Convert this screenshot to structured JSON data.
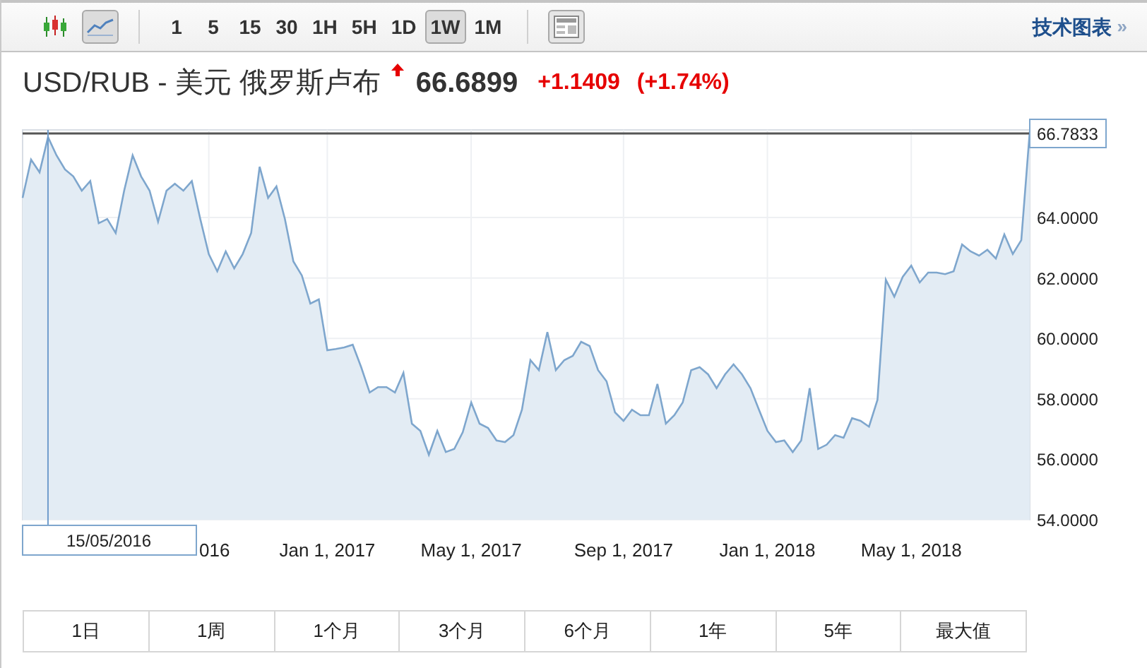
{
  "toolbar": {
    "chart_types": [
      {
        "kind": "candlestick",
        "selected": false
      },
      {
        "kind": "line",
        "selected": true
      }
    ],
    "intervals": [
      {
        "label": "1",
        "selected": false
      },
      {
        "label": "5",
        "selected": false
      },
      {
        "label": "15",
        "selected": false
      },
      {
        "label": "30",
        "selected": false
      },
      {
        "label": "1H",
        "selected": false
      },
      {
        "label": "5H",
        "selected": false
      },
      {
        "label": "1D",
        "selected": false
      },
      {
        "label": "1W",
        "selected": true
      },
      {
        "label": "1M",
        "selected": false
      }
    ],
    "link": {
      "label": "技术图表",
      "arrow": "»"
    }
  },
  "quote": {
    "name": "USD/RUB - 美元 俄罗斯卢布",
    "rising": true,
    "price": "66.6899",
    "change": "+1.1409",
    "change_percent": "(+1.74%)"
  },
  "chart": {
    "price_label": "66.7833",
    "crosshair": {
      "label": "15/05/2016"
    },
    "chart_data": {
      "type": "area",
      "grid": true,
      "ylim": [
        54,
        66.9
      ],
      "yticks": [
        {
          "value": 54,
          "label": "54.0000"
        },
        {
          "value": 56,
          "label": "56.0000"
        },
        {
          "value": 58,
          "label": "58.0000"
        },
        {
          "value": 60,
          "label": "60.0000"
        },
        {
          "value": 62,
          "label": "62.0000"
        },
        {
          "value": 64,
          "label": "64.0000"
        }
      ],
      "categories": [
        null,
        null,
        null,
        null,
        null,
        null,
        null,
        null,
        null,
        null,
        null,
        null,
        null,
        null,
        null,
        null,
        null,
        null,
        null,
        null,
        null,
        null,
        "016",
        null,
        null,
        null,
        null,
        null,
        null,
        null,
        null,
        null,
        null,
        null,
        null,
        null,
        "Jan 1, 2017",
        null,
        null,
        null,
        null,
        null,
        null,
        null,
        null,
        null,
        null,
        null,
        null,
        null,
        null,
        null,
        null,
        "May 1, 2017",
        null,
        null,
        null,
        null,
        null,
        null,
        null,
        null,
        null,
        null,
        null,
        null,
        null,
        null,
        null,
        null,
        null,
        "Sep 1, 2017",
        null,
        null,
        null,
        null,
        null,
        null,
        null,
        null,
        null,
        null,
        null,
        null,
        null,
        null,
        null,
        null,
        "Jan 1, 2018",
        null,
        null,
        null,
        null,
        null,
        null,
        null,
        null,
        null,
        null,
        null,
        null,
        null,
        null,
        null,
        null,
        "May 1, 2018",
        null,
        null,
        null,
        null,
        null,
        null,
        null,
        null,
        null,
        null,
        null,
        null,
        null,
        null
      ],
      "values": [
        64.65,
        65.92,
        65.5,
        66.66,
        66.06,
        65.59,
        65.36,
        64.89,
        65.21,
        63.81,
        63.95,
        63.49,
        64.89,
        66.06,
        65.36,
        64.89,
        63.86,
        64.89,
        65.12,
        64.89,
        65.21,
        63.95,
        62.79,
        62.22,
        62.88,
        62.32,
        62.79,
        63.49,
        65.68,
        64.65,
        65.03,
        63.95,
        62.55,
        62.08,
        61.15,
        61.29,
        59.61,
        59.65,
        59.7,
        59.79,
        59.05,
        58.21,
        58.39,
        58.39,
        58.21,
        58.86,
        57.18,
        56.94,
        56.15,
        56.94,
        56.24,
        56.34,
        56.9,
        57.88,
        57.18,
        57.04,
        56.62,
        56.57,
        56.8,
        57.64,
        59.28,
        58.95,
        60.21,
        58.95,
        59.28,
        59.42,
        59.89,
        59.75,
        58.95,
        58.58,
        57.55,
        57.27,
        57.64,
        57.46,
        57.46,
        58.49,
        57.18,
        57.46,
        57.88,
        58.95,
        59.05,
        58.81,
        58.35,
        58.81,
        59.14,
        58.81,
        58.35,
        57.64,
        56.94,
        56.57,
        56.62,
        56.24,
        56.62,
        58.35,
        56.34,
        56.48,
        56.8,
        56.71,
        57.36,
        57.27,
        57.08,
        57.97,
        61.94,
        61.38,
        62.04,
        62.41,
        61.85,
        62.18,
        62.18,
        62.13,
        62.22,
        63.11,
        62.88,
        62.74,
        62.93,
        62.64,
        63.44,
        62.79,
        63.25,
        66.85
      ]
    }
  },
  "ranges": [
    {
      "label": "1日"
    },
    {
      "label": "1周"
    },
    {
      "label": "1个月"
    },
    {
      "label": "3个月"
    },
    {
      "label": "6个月"
    },
    {
      "label": "1年"
    },
    {
      "label": "5年"
    },
    {
      "label": "最大值"
    }
  ]
}
